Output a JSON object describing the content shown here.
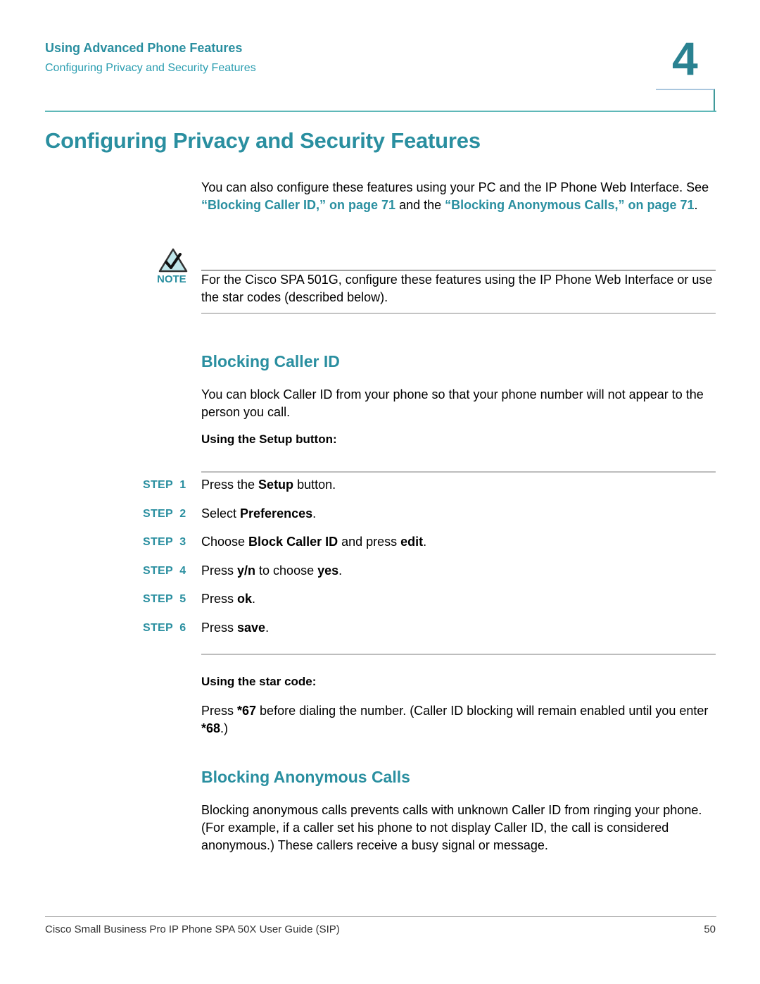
{
  "header": {
    "chapter_title": "Using Advanced Phone Features",
    "section_title": "Configuring Privacy and Security Features",
    "chapter_number": "4"
  },
  "page_title": "Configuring Privacy and Security Features",
  "intro": {
    "text_1": "You can also configure these features using your PC and the IP Phone Web Interface. See ",
    "link_1": "“Blocking Caller ID,” on page 71",
    "text_2": " and the ",
    "link_2": "“Blocking Anonymous Calls,” on page 71",
    "text_3": "."
  },
  "note": {
    "icon": "checkmark-warning-icon",
    "label": "NOTE",
    "text": "For the Cisco SPA 501G, configure these features using the IP Phone Web Interface or use the star codes (described below)."
  },
  "blocking_caller_id": {
    "heading": "Blocking Caller ID",
    "description": "You can block Caller ID from your phone so that your phone number will not appear to the person you call.",
    "setup_label": "Using the Setup button:",
    "steps": [
      {
        "label": "STEP  1",
        "parts": [
          {
            "t": "Press the "
          },
          {
            "t": "Setup",
            "b": true
          },
          {
            "t": " button."
          }
        ]
      },
      {
        "label": "STEP  2",
        "parts": [
          {
            "t": "Select "
          },
          {
            "t": "Preferences",
            "b": true
          },
          {
            "t": "."
          }
        ]
      },
      {
        "label": "STEP  3",
        "parts": [
          {
            "t": "Choose "
          },
          {
            "t": "Block Caller ID",
            "b": true
          },
          {
            "t": " and press "
          },
          {
            "t": "edit",
            "b": true
          },
          {
            "t": "."
          }
        ]
      },
      {
        "label": "STEP  4",
        "parts": [
          {
            "t": "Press "
          },
          {
            "t": "y/n",
            "b": true
          },
          {
            "t": " to choose "
          },
          {
            "t": "yes",
            "b": true
          },
          {
            "t": "."
          }
        ]
      },
      {
        "label": "STEP  5",
        "parts": [
          {
            "t": "Press "
          },
          {
            "t": "ok",
            "b": true
          },
          {
            "t": "."
          }
        ]
      },
      {
        "label": "STEP  6",
        "parts": [
          {
            "t": "Press "
          },
          {
            "t": "save",
            "b": true
          },
          {
            "t": "."
          }
        ]
      }
    ],
    "star_label": "Using the star code:",
    "star_text_1": "Press ",
    "star_code_on": "*67",
    "star_text_2": " before dialing the number. (Caller ID blocking will remain enabled until you enter ",
    "star_code_off": "*68",
    "star_text_3": ".)"
  },
  "blocking_anonymous": {
    "heading": "Blocking Anonymous Calls",
    "description": "Blocking anonymous calls prevents calls with unknown Caller ID from ringing your phone. (For example, if a caller set his phone to not display Caller ID, the call is considered anonymous.) These callers receive a busy signal or message."
  },
  "footer": {
    "guide_title": "Cisco Small Business Pro IP Phone SPA 50X User Guide (SIP)",
    "page_number": "50"
  },
  "colors": {
    "accent": "#2a8fa0",
    "rule_teal": "#5fb8b8",
    "rule_gray": "#bdbdbd"
  }
}
